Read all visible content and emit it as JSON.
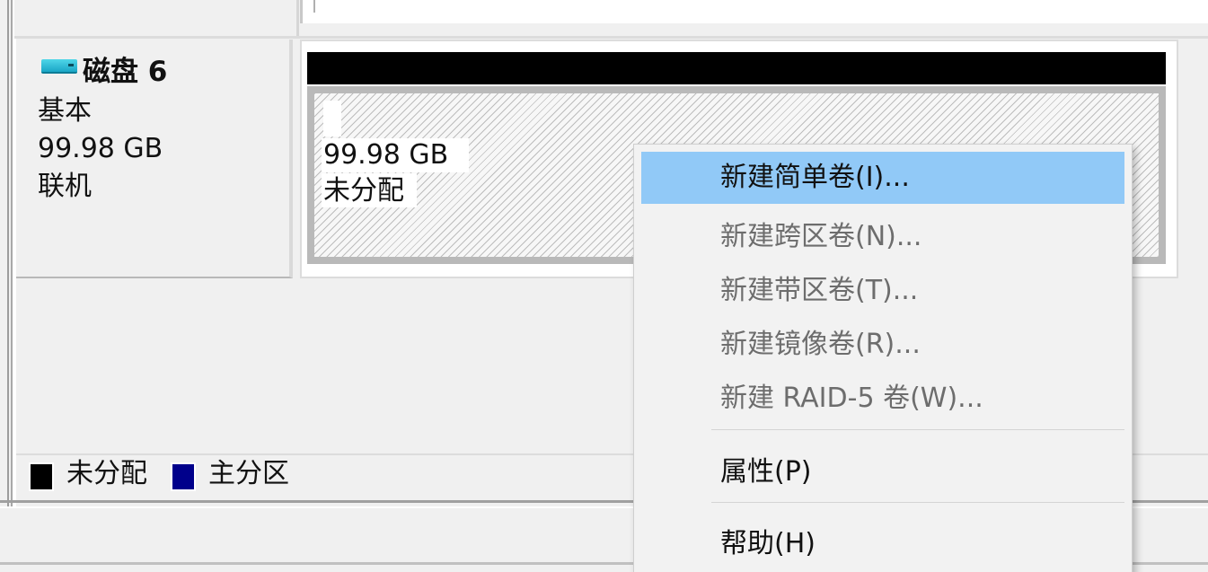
{
  "disk": {
    "name": "磁盘 6",
    "type": "基本",
    "size": "99.98 GB",
    "status": "联机",
    "icon": "disk-drive-icon"
  },
  "volume": {
    "size": "99.98 GB",
    "status": "未分配",
    "header_color": "#000000"
  },
  "legend": [
    {
      "label": "未分配",
      "color": "#000000"
    },
    {
      "label": "主分区",
      "color": "#00008b"
    }
  ],
  "context_menu": {
    "items": [
      {
        "label": "新建简单卷(I)...",
        "enabled": true,
        "highlighted": true
      },
      {
        "label": "新建跨区卷(N)...",
        "enabled": false
      },
      {
        "label": "新建带区卷(T)...",
        "enabled": false
      },
      {
        "label": "新建镜像卷(R)...",
        "enabled": false
      },
      {
        "label": "新建 RAID-5 卷(W)...",
        "enabled": false
      },
      {
        "label": "属性(P)",
        "enabled": true
      },
      {
        "label": "帮助(H)",
        "enabled": true
      }
    ],
    "highlight_color": "#91c9f7"
  }
}
